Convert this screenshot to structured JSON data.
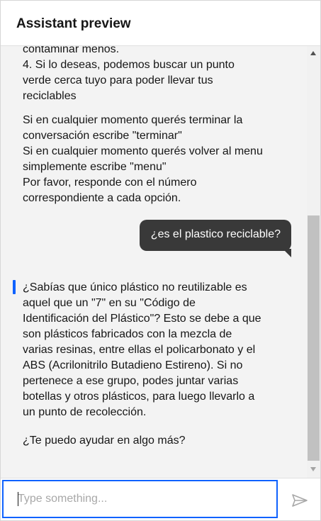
{
  "header": {
    "title": "Assistant preview"
  },
  "messages": {
    "bot_previous": {
      "cut_line": "contaminar menos.",
      "lines": [
        "4. Si lo deseas, podemos buscar un punto",
        "verde cerca tuyo para poder llevar tus",
        "reciclables"
      ]
    },
    "bot_instructions": {
      "lines": [
        "Si en cualquier momento querés terminar la",
        "conversación escribe \"terminar\"",
        "Si en cualquier momento querés volver al menu",
        "simplemente escribe \"menu\"",
        "Por favor, responde con el número",
        "correspondiente a cada opción."
      ]
    },
    "user": {
      "text": "¿es el plastico reciclable?"
    },
    "bot_answer": {
      "lines": [
        "¿Sabías que único plástico no reutilizable es",
        "aquel que un \"7\" en su \"Código de",
        "Identificación del Plástico\"? Esto se debe a que",
        "son plásticos fabricados con la mezcla de",
        "varias resinas, entre ellas el policarbonato y el",
        "ABS (Acrilonitrilo Butadieno Estireno). Si no",
        "pertenece a ese grupo, podes juntar varias",
        "botellas y otros plásticos, para luego llevarlo a",
        "un punto de recolección."
      ]
    },
    "bot_followup": {
      "text": "¿Te puedo ayudar en algo más?"
    }
  },
  "input": {
    "placeholder": "Type something...",
    "value": ""
  },
  "icons": {
    "send": "send-icon",
    "scroll_up": "scroll-up-arrow-icon",
    "scroll_down": "scroll-down-arrow-icon"
  },
  "colors": {
    "accent": "#0f62fe",
    "user_bubble": "#393939",
    "chat_background": "#f3f3f3"
  }
}
